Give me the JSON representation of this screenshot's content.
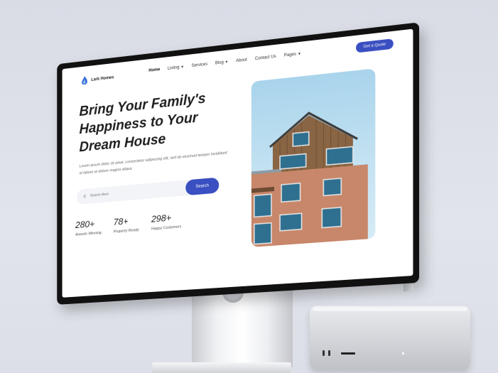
{
  "brand": {
    "name": "Lark Homes"
  },
  "nav": {
    "items": [
      {
        "label": "Home",
        "active": true,
        "dropdown": false
      },
      {
        "label": "Listing",
        "active": false,
        "dropdown": true
      },
      {
        "label": "Services",
        "active": false,
        "dropdown": false
      },
      {
        "label": "Blog",
        "active": false,
        "dropdown": true
      },
      {
        "label": "About",
        "active": false,
        "dropdown": false
      },
      {
        "label": "Contact Us",
        "active": false,
        "dropdown": false
      },
      {
        "label": "Pages",
        "active": false,
        "dropdown": true
      }
    ],
    "cta_label": "Get a Quote"
  },
  "hero": {
    "headline_line1": "Bring Your Family's",
    "headline_line2": "Happiness to Your",
    "headline_line3": "Dream House",
    "description": "Lorem ipsum dolor sit amet, consectetur adipiscing elit, sed do eiusmod tempor incididunt ut labore et dolore magna aliqua.",
    "search_placeholder": "Search Here",
    "search_button": "Search"
  },
  "stats": [
    {
      "value": "280+",
      "label": "Awards Winning"
    },
    {
      "value": "78+",
      "label": "Property Ready"
    },
    {
      "value": "298+",
      "label": "Happy Customers"
    }
  ],
  "colors": {
    "accent": "#3a4fc1",
    "background": "#dde0e8"
  },
  "icons": {
    "search": "search-icon",
    "caret": "chevron-down-icon",
    "logo": "flame-logo-icon"
  }
}
